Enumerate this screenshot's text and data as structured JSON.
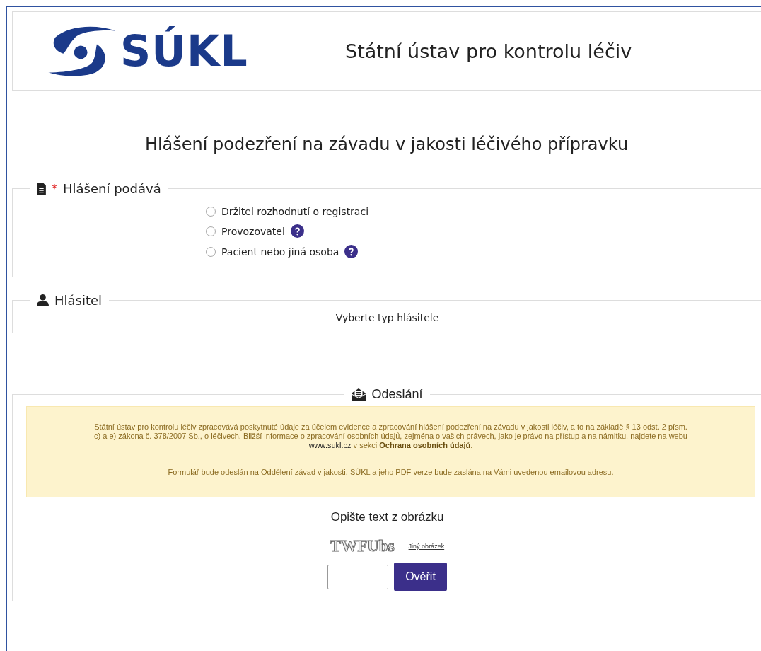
{
  "header": {
    "logo_text": "SÚKL",
    "title": "Státní ústav pro kontrolu léčiv"
  },
  "page_title": "Hlášení podezření na závadu v jakosti léčivého přípravku",
  "reporter_type": {
    "legend": "Hlášení podává",
    "required_mark": "*",
    "options": [
      {
        "label": "Držitel rozhodnutí o registraci",
        "selected": false,
        "help": false
      },
      {
        "label": "Provozovatel",
        "selected": false,
        "help": true
      },
      {
        "label": "Pacient nebo jiná osoba",
        "selected": false,
        "help": true
      }
    ]
  },
  "reporter": {
    "legend": "Hlásitel",
    "message": "Vyberte typ hlásitele"
  },
  "submission": {
    "legend": "Odeslání",
    "notice": {
      "text_before": "Státní ústav pro kontrolu léčiv zpracovává poskytnuté údaje za účelem evidence a zpracování hlášení podezření na závadu v jakosti léčiv, a to na základě § 13 odst. 2 písm. c) a e) zákona č. 378/2007 Sb., o léčivech. Bližší informace o zpracování osobních údajů, zejména o vašich právech, jako je právo na přístup a na námitku, najdete na webu",
      "web": "www.sukl.cz",
      "text_mid": "v sekci",
      "link": "Ochrana osobních údajů",
      "text_end": ".",
      "second": "Formulář bude odeslán na Oddělení závad v jakosti, SÚKL a jeho PDF verze bude zaslána na Vámi uvedenou emailovou adresu."
    },
    "captcha": {
      "prompt": "Opište text z obrázku",
      "image_text": "TWFUbs",
      "refresh_link": "Jiný obrázek",
      "button": "Ověřit"
    }
  }
}
